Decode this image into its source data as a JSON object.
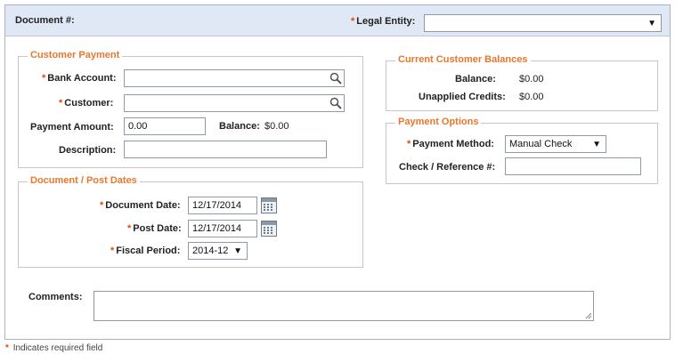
{
  "header": {
    "document_label": "Document #:",
    "legal_entity_label": "Legal Entity:",
    "legal_entity_value": ""
  },
  "customer_payment": {
    "legend": "Customer Payment",
    "bank_account_label": "Bank Account:",
    "bank_account_value": "",
    "customer_label": "Customer:",
    "customer_value": "",
    "payment_amount_label": "Payment Amount:",
    "payment_amount_value": "0.00",
    "balance_label": "Balance:",
    "balance_value": "$0.00",
    "description_label": "Description:",
    "description_value": ""
  },
  "current_balances": {
    "legend": "Current Customer Balances",
    "balance_label": "Balance:",
    "balance_value": "$0.00",
    "unapplied_label": "Unapplied Credits:",
    "unapplied_value": "$0.00"
  },
  "payment_options": {
    "legend": "Payment Options",
    "method_label": "Payment Method:",
    "method_value": "Manual Check",
    "reference_label": "Check / Reference #:",
    "reference_value": ""
  },
  "dates": {
    "legend": "Document / Post Dates",
    "document_date_label": "Document Date:",
    "document_date_value": "12/17/2014",
    "post_date_label": "Post Date:",
    "post_date_value": "12/17/2014",
    "fiscal_period_label": "Fiscal Period:",
    "fiscal_period_value": "2014-12"
  },
  "comments": {
    "label": "Comments:",
    "value": ""
  },
  "footer": {
    "asterisk": "*",
    "note": "Indicates required field"
  },
  "colors": {
    "header_bg": "#dfe8f4",
    "legend_orange": "#e8772e",
    "required_red": "#e04a0a"
  },
  "icons": {
    "lookup": "magnifier-icon",
    "calendar": "calendar-icon",
    "dropdown": "chevron-down-icon"
  }
}
